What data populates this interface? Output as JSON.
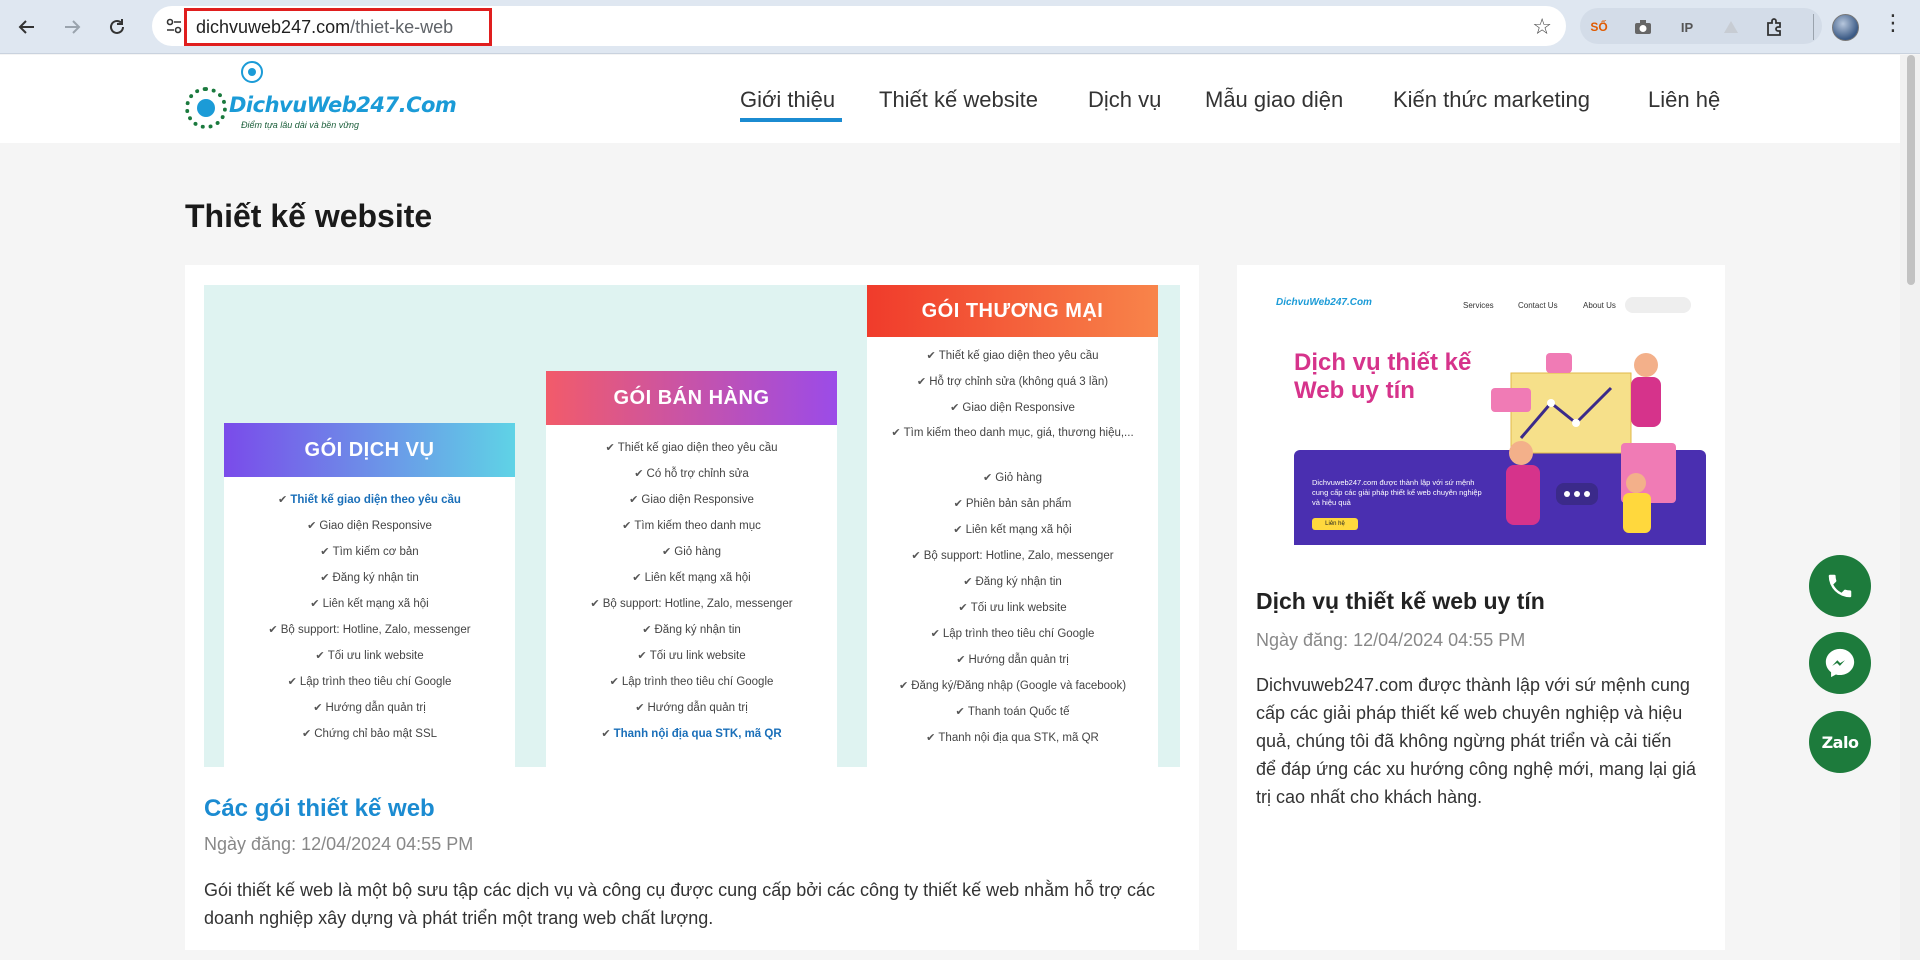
{
  "browser": {
    "url_domain": "dichvuweb247.com",
    "url_path": "/thiet-ke-web",
    "back_icon": "back-arrow-icon",
    "forward_icon": "forward-arrow-icon",
    "reload_icon": "reload-icon",
    "extensions": [
      {
        "name": "so-extension",
        "label": "SỐ"
      },
      {
        "name": "camera-icon",
        "label": ""
      },
      {
        "name": "ip-extension",
        "label": "IP"
      },
      {
        "name": "triangle-extension",
        "label": ""
      },
      {
        "name": "puzzle-extensions-icon",
        "label": ""
      }
    ]
  },
  "site": {
    "logo_text": "DichvuWeb247.Com",
    "logo_tagline": "Điểm tựa lâu dài và bền vững",
    "menu": [
      {
        "label": "Giới thiệu"
      },
      {
        "label": "Thiết kế website"
      },
      {
        "label": "Dịch vụ"
      },
      {
        "label": "Mẫu giao diện"
      },
      {
        "label": "Kiến thức marketing"
      },
      {
        "label": "Liên hệ"
      }
    ],
    "active_menu_index": 0
  },
  "page": {
    "title": "Thiết kế website"
  },
  "pricing": {
    "packages": [
      {
        "name": "GÓI DỊCH VỤ",
        "items": [
          "Thiết kế giao diện theo yêu cầu",
          "Giao diện Responsive",
          "Tìm kiếm cơ bản",
          "Đăng ký nhận tin",
          "Liên kết mạng xã hội",
          "Bộ support: Hotline, Zalo, messenger",
          "Tối ưu link website",
          "Lập trình theo tiêu chí Google",
          "Hướng dẫn quản trị",
          "Chứng chỉ bảo mật SSL"
        ]
      },
      {
        "name": "GÓI BÁN HÀNG",
        "items": [
          "Thiết kế giao diện theo yêu cầu",
          "Có hỗ trợ chỉnh sửa",
          "Giao diện Responsive",
          "Tìm kiếm theo danh mục",
          "Giỏ hàng",
          "Liên kết mạng xã hội",
          "Bộ support: Hotline, Zalo, messenger",
          "Đăng ký nhận tin",
          "Tối ưu link website",
          "Lập trình theo tiêu chí Google",
          "Hướng dẫn quản trị",
          "Thanh nội địa qua STK, mã QR"
        ]
      },
      {
        "name": "GÓI THƯƠNG MẠI",
        "items": [
          "Thiết kế giao diện theo yêu cầu",
          "Hỗ trợ chỉnh sửa (không quá 3 lần)",
          "Giao diện Responsive",
          "Tìm kiếm theo danh mục, giá, thương hiệu,...",
          "Giỏ hàng",
          "Phiên bản sản phẩm",
          "Liên kết mạng xã hội",
          "Bộ support: Hotline, Zalo, messenger",
          "Đăng ký nhận tin",
          "Tối ưu link website",
          "Lập trình theo tiêu chí Google",
          "Hướng dẫn quản trị",
          "Đăng ký/Đăng nhập (Google và facebook)",
          "Thanh toán Quốc tế",
          "Thanh nội địa qua STK, mã QR"
        ]
      }
    ]
  },
  "posts": [
    {
      "title": "Các gói thiết kế web",
      "date": "Ngày đăng: 12/04/2024 04:55 PM",
      "excerpt": "Gói thiết kế web là một bộ sưu tập các dịch vụ và công cụ được cung cấp bởi các công ty thiết kế web nhằm hỗ trợ các doanh nghiệp xây dựng và phát triển một trang web chất lượng."
    },
    {
      "title": "Dịch vụ thiết kế web uy tín",
      "date": "Ngày đăng: 12/04/2024 04:55 PM",
      "excerpt": "Dichvuweb247.com được thành lập với sứ mệnh cung cấp các giải pháp thiết kế web chuyên nghiệp và hiệu quả, chúng tôi đã không ngừng phát triển và cải tiến để đáp ứng các xu hướng công nghệ mới, mang lại giá trị cao nhất cho khách hàng."
    }
  ],
  "thumbnail": {
    "logo": "DichvuWeb247.Com",
    "nav": [
      "Services",
      "Contact Us",
      "About Us"
    ],
    "title": "Dịch vụ thiết kế Web uy tín",
    "desc": "Dichvuweb247.com được thành lập với sứ mệnh cung cấp các giải pháp thiết kế web chuyên nghiệp và hiệu quả",
    "button": "Liên hệ"
  },
  "floating": {
    "zalo_label": "Zalo"
  },
  "colors": {
    "accent": "#1b8bd1",
    "float_green": "#1d7b3c",
    "url_highlight": "#e01e1e"
  }
}
